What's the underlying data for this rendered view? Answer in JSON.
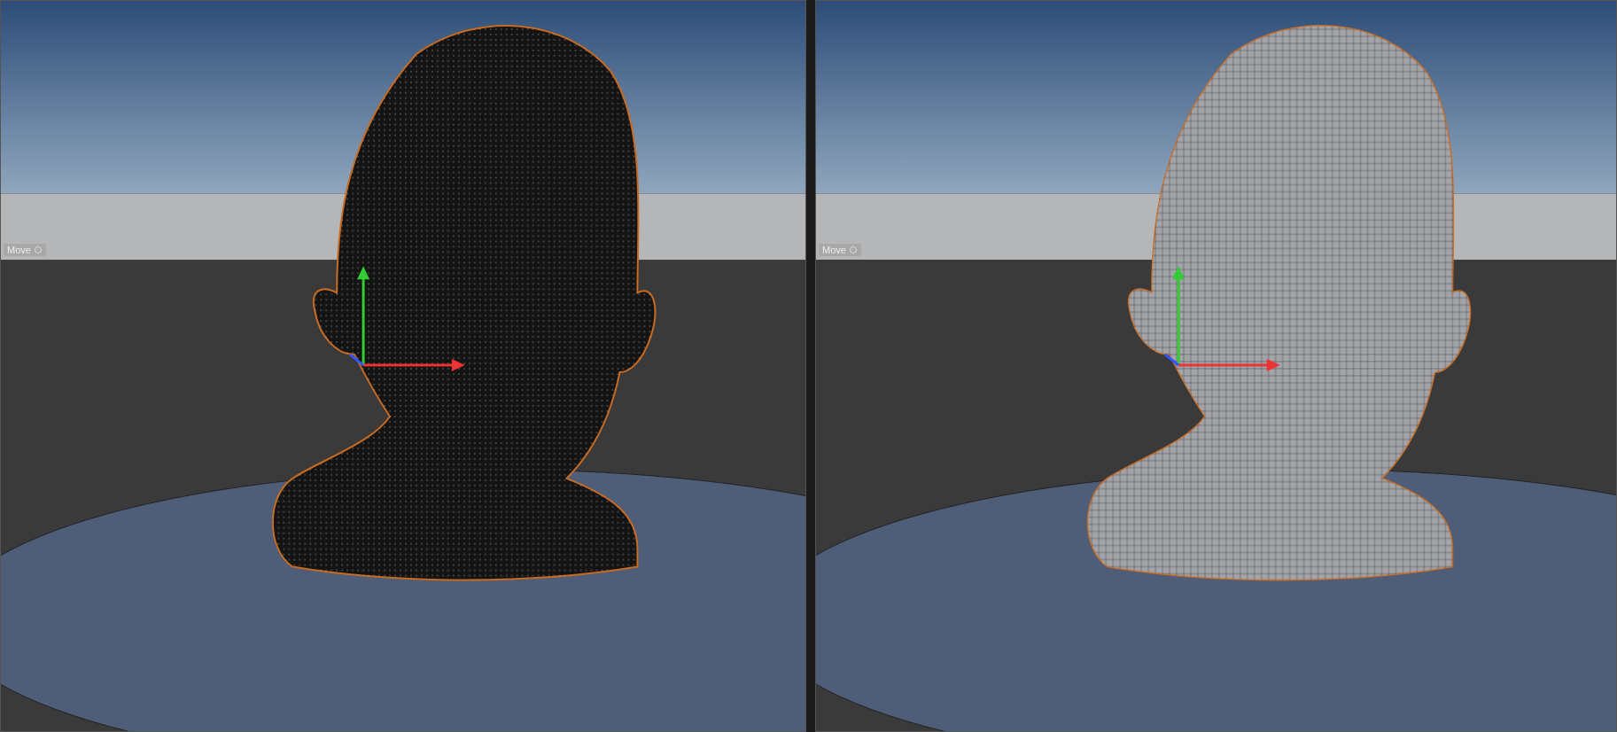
{
  "viewports": [
    {
      "label": "Move",
      "kind": "point-cloud"
    },
    {
      "label": "Move",
      "kind": "quad-mesh"
    }
  ]
}
